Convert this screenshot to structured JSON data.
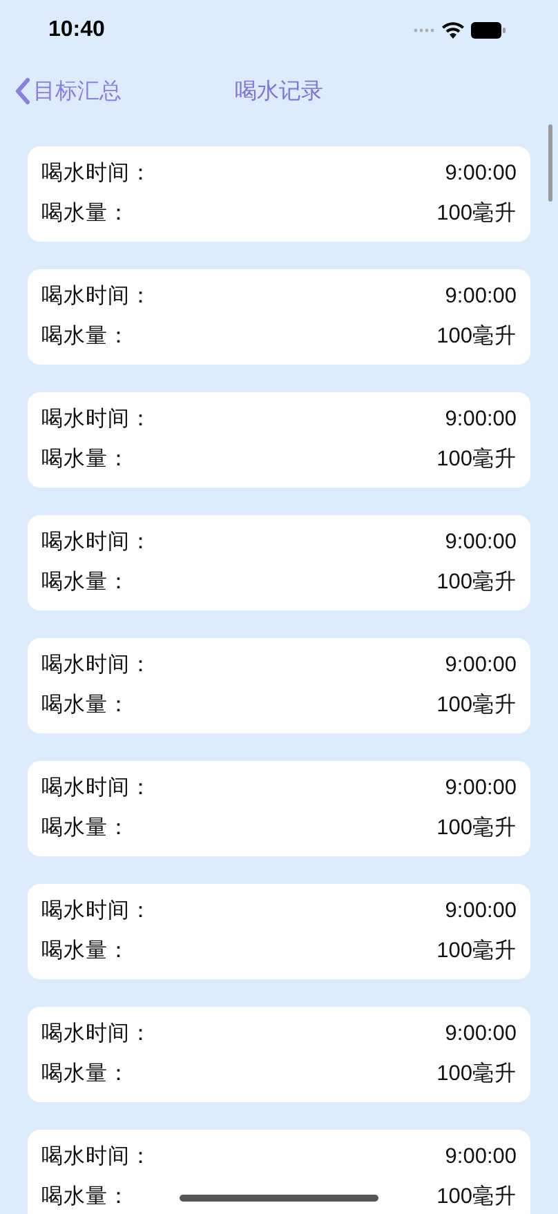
{
  "status_bar": {
    "time": "10:40"
  },
  "nav": {
    "back_label": "目标汇总",
    "title": "喝水记录"
  },
  "records": [
    {
      "time_label": "喝水时间：",
      "time": "9:00:00",
      "amount_label": "喝水量：",
      "amount": "100毫升"
    },
    {
      "time_label": "喝水时间：",
      "time": "9:00:00",
      "amount_label": "喝水量：",
      "amount": "100毫升"
    },
    {
      "time_label": "喝水时间：",
      "time": "9:00:00",
      "amount_label": "喝水量：",
      "amount": "100毫升"
    },
    {
      "time_label": "喝水时间：",
      "time": "9:00:00",
      "amount_label": "喝水量：",
      "amount": "100毫升"
    },
    {
      "time_label": "喝水时间：",
      "time": "9:00:00",
      "amount_label": "喝水量：",
      "amount": "100毫升"
    },
    {
      "time_label": "喝水时间：",
      "time": "9:00:00",
      "amount_label": "喝水量：",
      "amount": "100毫升"
    },
    {
      "time_label": "喝水时间：",
      "time": "9:00:00",
      "amount_label": "喝水量：",
      "amount": "100毫升"
    },
    {
      "time_label": "喝水时间：",
      "time": "9:00:00",
      "amount_label": "喝水量：",
      "amount": "100毫升"
    },
    {
      "time_label": "喝水时间：",
      "time": "9:00:00",
      "amount_label": "喝水量：",
      "amount": "100毫升"
    }
  ]
}
